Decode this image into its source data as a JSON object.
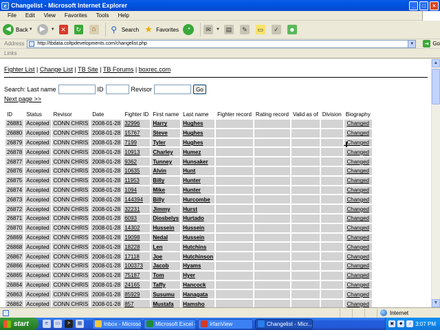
{
  "window": {
    "title": "Changelist - Microsoft Internet Explorer",
    "app_icon": "e"
  },
  "menu": [
    "File",
    "Edit",
    "View",
    "Favorites",
    "Tools",
    "Help"
  ],
  "toolbar": {
    "back_label": "Back",
    "search_label": "Search",
    "favorites_label": "Favorites"
  },
  "address": {
    "label": "Address",
    "url": "http://tbdata.coltpdevelopments.com/changelist.php",
    "go_label": "Go"
  },
  "links_label": "Links",
  "page": {
    "nav": [
      "Fighter List",
      "Change List",
      "TB Site",
      "TB Forums",
      "boxrec.com"
    ],
    "nav_sep": "|",
    "search": {
      "label_lastname": "Search: Last name",
      "label_id": "ID",
      "label_revisor": "Revisor",
      "go_label": "Go",
      "lastname_value": "",
      "id_value": "",
      "revisor_value": ""
    },
    "next_page": "Next page >>",
    "columns": [
      "ID",
      "Status",
      "Revisor",
      "Date",
      "Fighter ID",
      "First name",
      "Last name",
      "Fighter record",
      "Rating record",
      "Valid as of",
      "Division",
      "Biography"
    ],
    "rows": [
      [
        "26881",
        "Accepted",
        "CONN CHRIS",
        "2008-01-28",
        "32996",
        "Harry",
        "Hughes",
        "",
        "",
        "",
        "",
        "Changed"
      ],
      [
        "26880",
        "Accepted",
        "CONN CHRIS",
        "2008-01-28",
        "15767",
        "Steve",
        "Hughes",
        "",
        "",
        "",
        "",
        "Changed"
      ],
      [
        "26879",
        "Accepted",
        "CONN CHRIS",
        "2008-01-28",
        "7199",
        "Tyler",
        "Hughes",
        "",
        "",
        "",
        "",
        "Changed"
      ],
      [
        "26878",
        "Accepted",
        "CONN CHRIS",
        "2008-01-28",
        "10913",
        "Charley",
        "Humez",
        "",
        "",
        "",
        "",
        "Changed"
      ],
      [
        "26877",
        "Accepted",
        "CONN CHRIS",
        "2008-01-28",
        "9362",
        "Tunney",
        "Hunsaker",
        "",
        "",
        "",
        "",
        "Changed"
      ],
      [
        "26876",
        "Accepted",
        "CONN CHRIS",
        "2008-01-28",
        "10635",
        "Alvin",
        "Hunt",
        "",
        "",
        "",
        "",
        "Changed"
      ],
      [
        "26875",
        "Accepted",
        "CONN CHRIS",
        "2008-01-28",
        "11953",
        "Billy",
        "Hunter",
        "",
        "",
        "",
        "",
        "Changed"
      ],
      [
        "26874",
        "Accepted",
        "CONN CHRIS",
        "2008-01-28",
        "1094",
        "Mike",
        "Hunter",
        "",
        "",
        "",
        "",
        "Changed"
      ],
      [
        "26873",
        "Accepted",
        "CONN CHRIS",
        "2008-01-28",
        "144394",
        "Billy",
        "Hurcombe",
        "",
        "",
        "",
        "",
        "Changed"
      ],
      [
        "26872",
        "Accepted",
        "CONN CHRIS",
        "2008-01-28",
        "32231",
        "Jimmy",
        "Hurst",
        "",
        "",
        "",
        "",
        "Changed"
      ],
      [
        "26871",
        "Accepted",
        "CONN CHRIS",
        "2008-01-28",
        "6093",
        "Diosbelys",
        "Hurtado",
        "",
        "",
        "",
        "",
        "Changed"
      ],
      [
        "26870",
        "Accepted",
        "CONN CHRIS",
        "2008-01-28",
        "14302",
        "Hussein",
        "Hussein",
        "",
        "",
        "",
        "",
        "Changed"
      ],
      [
        "26869",
        "Accepted",
        "CONN CHRIS",
        "2008-01-28",
        "19098",
        "Nedal",
        "Hussein",
        "",
        "",
        "",
        "",
        "Changed"
      ],
      [
        "26868",
        "Accepted",
        "CONN CHRIS",
        "2008-01-28",
        "18228",
        "Len",
        "Hutchins",
        "",
        "",
        "",
        "",
        "Changed"
      ],
      [
        "26867",
        "Accepted",
        "CONN CHRIS",
        "2008-01-28",
        "17118",
        "Joe",
        "Hutchinson",
        "",
        "",
        "",
        "",
        "Changed"
      ],
      [
        "26866",
        "Accepted",
        "CONN CHRIS",
        "2008-01-28",
        "100373",
        "Jacob",
        "Hyams",
        "",
        "",
        "",
        "",
        "Changed"
      ],
      [
        "26865",
        "Accepted",
        "CONN CHRIS",
        "2008-01-28",
        "75187",
        "Tom",
        "Hyer",
        "",
        "",
        "",
        "",
        "Changed"
      ],
      [
        "26864",
        "Accepted",
        "CONN CHRIS",
        "2008-01-28",
        "24165",
        "Taffy",
        "Hancock",
        "",
        "",
        "",
        "",
        "Changed"
      ],
      [
        "26863",
        "Accepted",
        "CONN CHRIS",
        "2008-01-28",
        "85929",
        "Susumu",
        "Hanagata",
        "",
        "",
        "",
        "",
        "Changed"
      ],
      [
        "26862",
        "Accepted",
        "CONN CHRIS",
        "2008-01-28",
        "857",
        "Mustafa",
        "Hamsho",
        "",
        "",
        "",
        "",
        "Changed"
      ]
    ]
  },
  "status": {
    "text": "",
    "zone": "Internet"
  },
  "taskbar": {
    "start_label": "start",
    "buttons": [
      {
        "label": "Inbox - Microsoft...",
        "color": "#f3c640"
      },
      {
        "label": "Microsoft Excel - ...",
        "color": "#1f8a3a"
      },
      {
        "label": "IrfanView",
        "color": "#d33a2a"
      },
      {
        "label": "Changelist - Micr...",
        "color": "#2b7de9"
      }
    ],
    "clock": "3:07 PM"
  }
}
